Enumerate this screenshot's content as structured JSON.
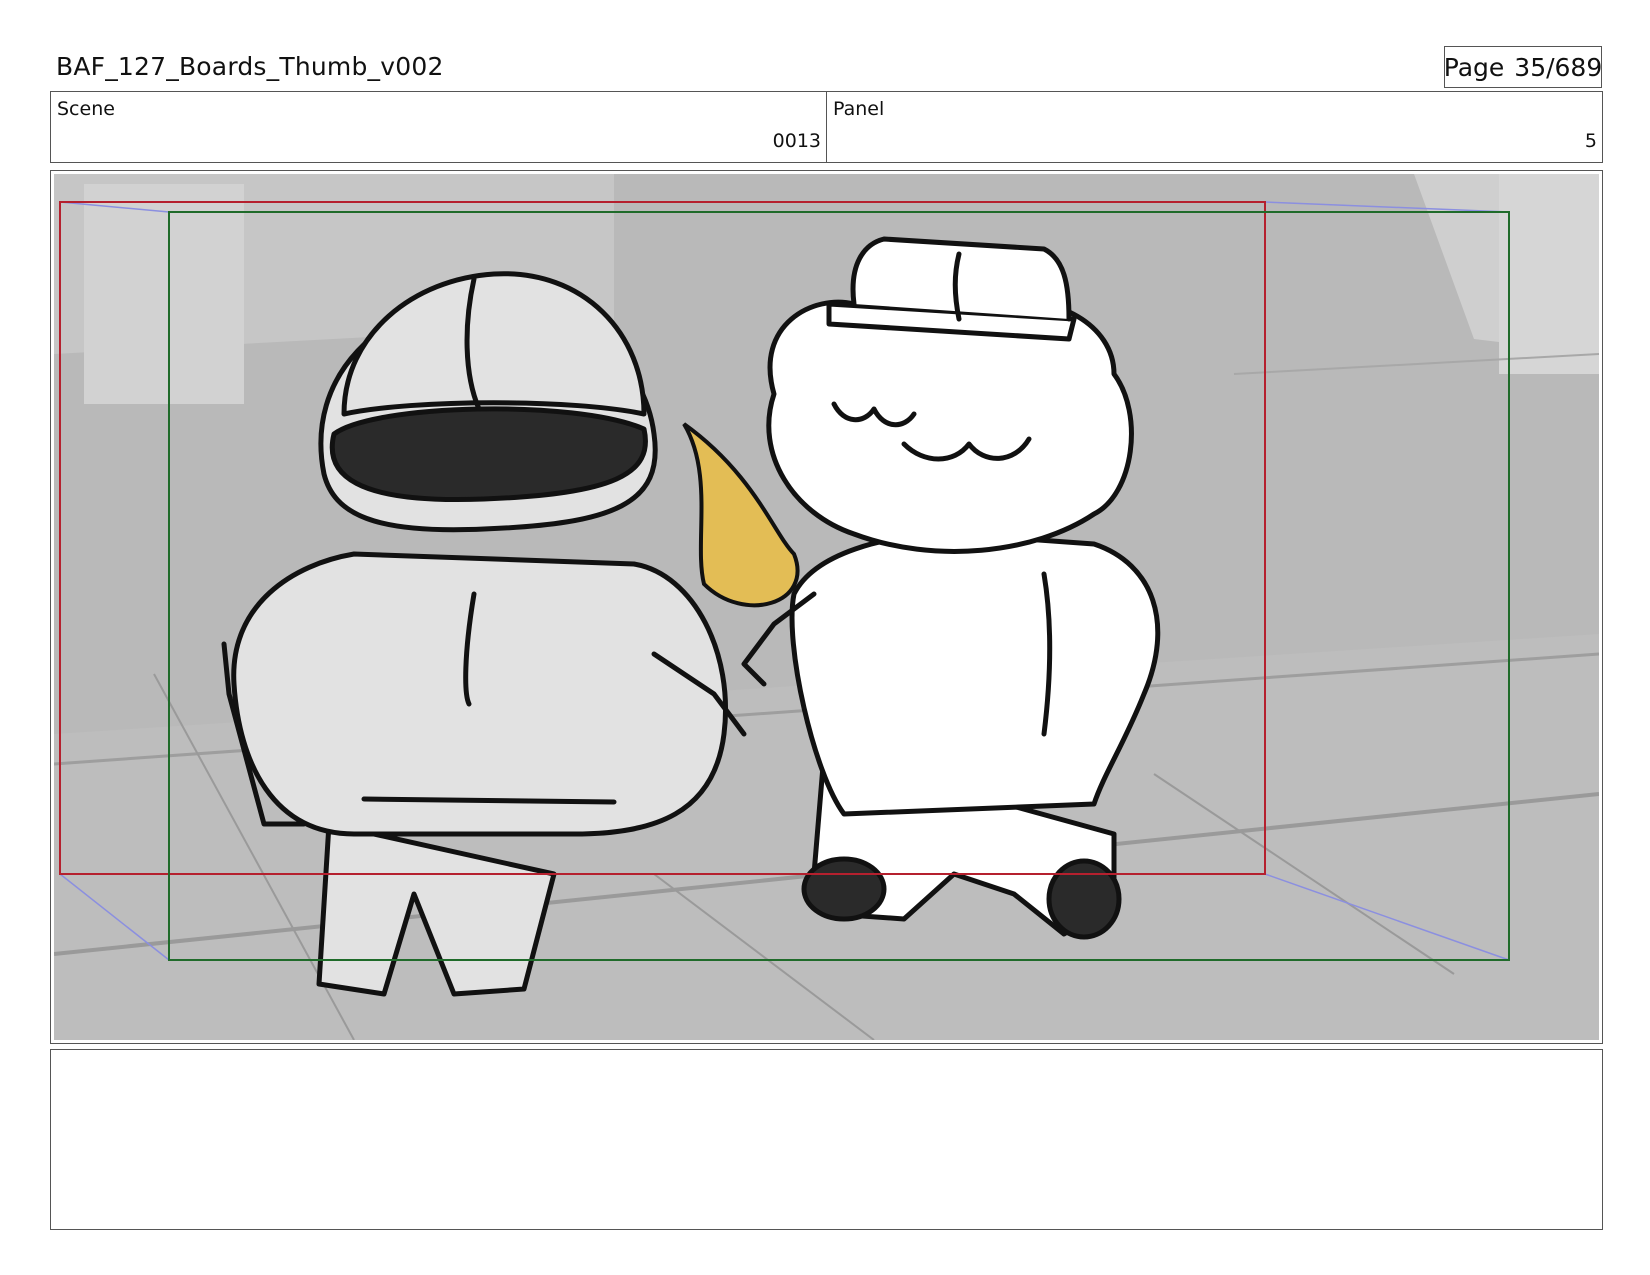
{
  "header": {
    "title": "BAF_127_Boards_Thumb_v002",
    "page_label": "Page",
    "page_value": "35/689"
  },
  "info": {
    "scene_label": "Scene",
    "scene_value": "0013",
    "panel_label": "Panel",
    "panel_value": "5"
  },
  "colors": {
    "action_safe": "#b5202e",
    "title_safe": "#1f6b2a",
    "camera_guide": "#8b8fe0",
    "horn": "#e3bd55"
  },
  "notes": {
    "text": ""
  }
}
